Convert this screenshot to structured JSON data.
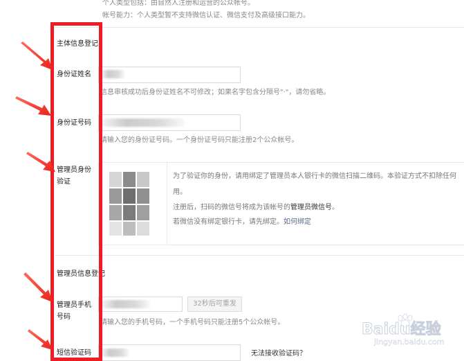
{
  "top": {
    "line1": "个人类型包括：由自然人注册和运营的公众帐号。",
    "line2": "帐号能力：个人类型暂不支持微信认证、微信支付及高级接口能力。"
  },
  "subject_section": {
    "title": "主体信息登记",
    "id_name_label": "身份证姓名",
    "id_name_hint": "信息审核成功后身份证姓名不可修改；如果名字包含分隔号\"·\"，请勿省略。",
    "id_number_label": "身份证号码",
    "id_number_hint": "请输入您的身份证号码。一个身份证号码只能注册2个公众帐号。",
    "admin_verify_label": "管理员身份验证",
    "verify_text_1": "为了验证你的身份，请用绑定了管理员本人银行卡的微信扫描二维码。本验证方式不扣除任何",
    "verify_text_2": "用。",
    "verify_text_3_prefix": "注册后，扫码的微信号将成为该帐号的",
    "verify_text_3_bold": "管理员微信号",
    "verify_text_3_suffix": "。",
    "verify_text_4_prefix": "若微信没有绑定银行卡，请先绑定。",
    "verify_text_4_link": "如何绑定"
  },
  "admin_section": {
    "title": "管理员信息登记",
    "phone_label": "管理员手机号码",
    "resend_button": "32秒后可重发",
    "phone_hint": "请输入您的手机号码，一个手机号码只能注册5个公众帐号。",
    "sms_label": "短信验证码",
    "sms_value": "",
    "no_code_link": "无法接收验证码？"
  },
  "watermark": {
    "brand": "Baidu经验",
    "url": "jingyan.baidu.com"
  },
  "colors": {
    "annotation_red": "#ee1c25",
    "hint_gray": "#888888",
    "border_gray": "#d9d9d9"
  }
}
